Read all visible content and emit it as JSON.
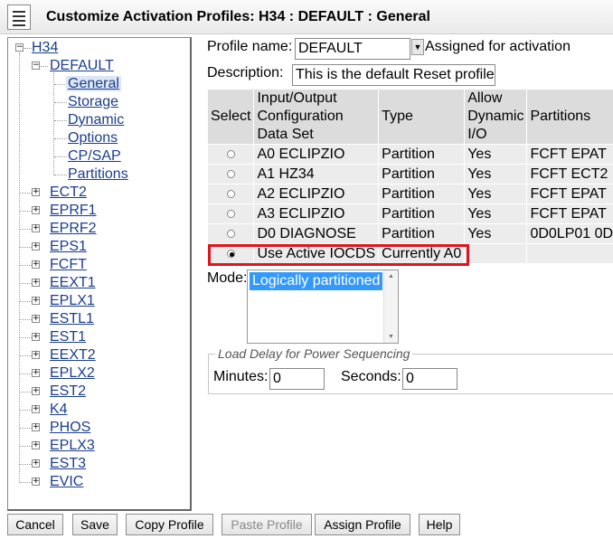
{
  "window": {
    "title": "Customize Activation Profiles: H34 : DEFAULT : General"
  },
  "tree": {
    "root": "H34",
    "profile": "DEFAULT",
    "pages": [
      "General",
      "Storage",
      "Dynamic",
      "Options",
      "CP/SAP",
      "Partitions"
    ],
    "selected_page": "General",
    "profiles": [
      "ECT2",
      "EPRF1",
      "EPRF2",
      "EPS1",
      "FCFT",
      "EEXT1",
      "EPLX1",
      "ESTL1",
      "EST1",
      "EEXT2",
      "EPLX2",
      "EST2",
      "K4",
      "PHOS",
      "EPLX3",
      "EST3",
      "EVIC"
    ]
  },
  "form": {
    "profile_name_label": "Profile name:",
    "profile_name_value": "DEFAULT",
    "assigned_label": "Assigned for activation",
    "description_label": "Description:",
    "description_value": "This is the default Reset profile"
  },
  "table": {
    "headers": [
      "Select",
      "Input/Output Configuration Data Set",
      "Type",
      "Allow Dynamic I/O",
      "Partitions"
    ],
    "rows": [
      {
        "selected": false,
        "iocds": "A0 ECLIPZIO",
        "type": "Partition",
        "dynamic": "Yes",
        "partitions": "FCFT EPAT"
      },
      {
        "selected": false,
        "iocds": "A1 HZ34",
        "type": "Partition",
        "dynamic": "Yes",
        "partitions": "FCFT ECT2"
      },
      {
        "selected": false,
        "iocds": "A2 ECLIPZIO",
        "type": "Partition",
        "dynamic": "Yes",
        "partitions": "FCFT EPAT"
      },
      {
        "selected": false,
        "iocds": "A3 ECLIPZIO",
        "type": "Partition",
        "dynamic": "Yes",
        "partitions": "FCFT EPAT"
      },
      {
        "selected": false,
        "iocds": "D0 DIAGNOSE",
        "type": "Partition",
        "dynamic": "Yes",
        "partitions": "0D0LP01 0D"
      },
      {
        "selected": true,
        "iocds": "Use Active IOCDS",
        "type": "Currently A0",
        "dynamic": "",
        "partitions": ""
      }
    ]
  },
  "mode": {
    "label": "Mode:",
    "selected": "Logically partitioned"
  },
  "load_delay": {
    "legend": "Load Delay for Power Sequencing",
    "minutes_label": "Minutes:",
    "minutes_value": "0",
    "seconds_label": "Seconds:",
    "seconds_value": "0"
  },
  "buttons": {
    "cancel": "Cancel",
    "save": "Save",
    "copy_profile": "Copy Profile",
    "paste_profile": "Paste Profile",
    "assign_profile": "Assign Profile",
    "help": "Help"
  },
  "colors": {
    "highlight_border": "#e0141e",
    "link": "#1a3e8c",
    "selected_option": "#3399ff"
  }
}
